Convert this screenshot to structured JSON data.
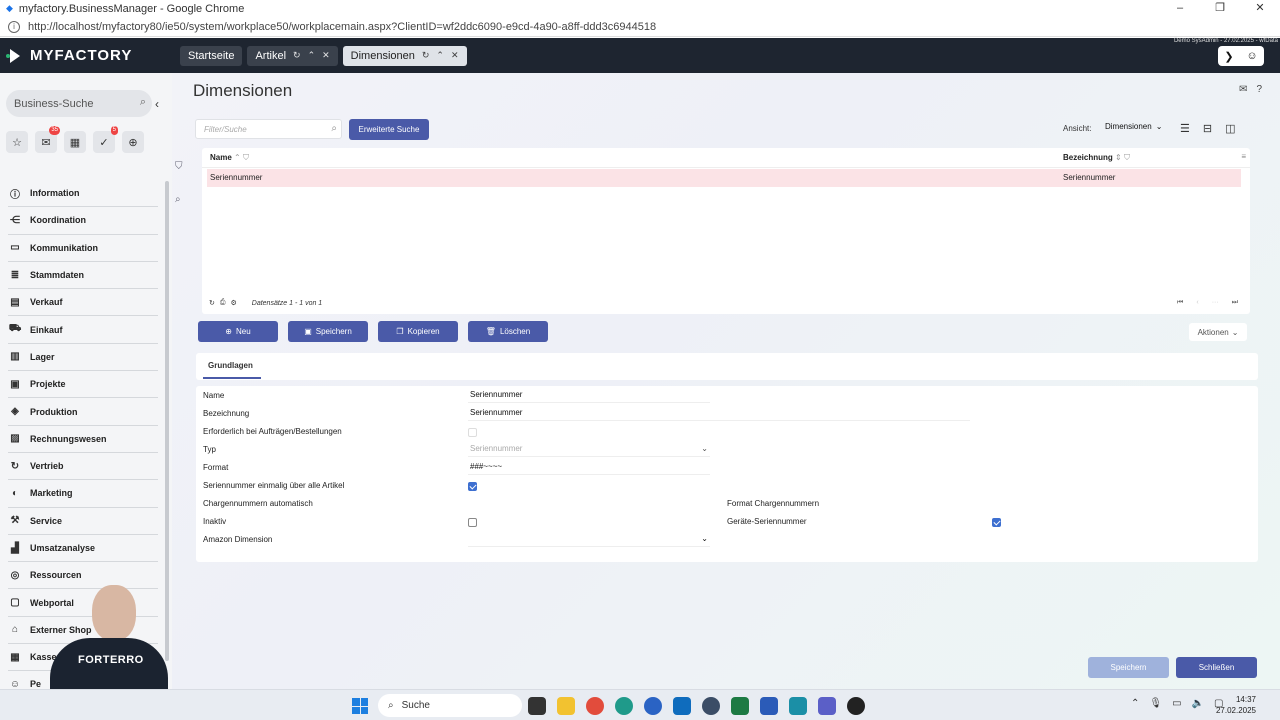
{
  "browser": {
    "window_title": "myfactory.BusinessManager - Google Chrome",
    "url": "http://localhost/myfactory80/ie50/system/workplace50/workplacemain.aspx?ClientID=wf2ddc6090-e9cd-4a90-a8ff-ddd3c6944518"
  },
  "header": {
    "logo": "MYFACTORY",
    "tabs": [
      {
        "label": "Startseite"
      },
      {
        "label": "Artikel"
      },
      {
        "label": "Dimensionen"
      }
    ],
    "user_info": "Demo SysAdmin - 27.02.2025 - wfData"
  },
  "sidebar": {
    "search_label": "Business-Suche",
    "quick_badges": {
      "mail": "35",
      "tasks": "5"
    },
    "items": [
      {
        "label": "Information"
      },
      {
        "label": "Koordination"
      },
      {
        "label": "Kommunikation"
      },
      {
        "label": "Stammdaten"
      },
      {
        "label": "Verkauf"
      },
      {
        "label": "Einkauf"
      },
      {
        "label": "Lager"
      },
      {
        "label": "Projekte"
      },
      {
        "label": "Produktion"
      },
      {
        "label": "Rechnungswesen"
      },
      {
        "label": "Vertrieb"
      },
      {
        "label": "Marketing"
      },
      {
        "label": "Service"
      },
      {
        "label": "Umsatzanalyse"
      },
      {
        "label": "Ressourcen"
      },
      {
        "label": "Webportal"
      },
      {
        "label": "Externer Shop"
      },
      {
        "label": "Kasse"
      },
      {
        "label": "Pe"
      }
    ],
    "overlay_text": "FORTERRO"
  },
  "main": {
    "title": "Dimensionen",
    "filter_placeholder": "Filter/Suche",
    "extended_search": "Erweiterte Suche",
    "view_label": "Ansicht:",
    "view_value": "Dimensionen",
    "grid": {
      "columns": [
        "Name",
        "Bezeichnung"
      ],
      "rows": [
        {
          "name": "Seriennummer",
          "bezeichnung": "Seriennummer"
        }
      ],
      "records": "Datensätze 1 - 1 von 1"
    },
    "actions": {
      "new": "Neu",
      "save": "Speichern",
      "copy": "Kopieren",
      "delete": "Löschen",
      "more": "Aktionen"
    },
    "tab": "Grundlagen",
    "form": {
      "name_label": "Name",
      "name_value": "Seriennummer",
      "bez_label": "Bezeichnung",
      "bez_value": "Seriennummer",
      "req_label": "Erforderlich bei Aufträgen/Bestellungen",
      "req_checked": false,
      "typ_label": "Typ",
      "typ_value": "Seriennummer",
      "format_label": "Format",
      "format_value": "###~~~~",
      "unique_label": "Seriennummer einmalig über alle Artikel",
      "unique_checked": true,
      "charge_auto_label": "Chargennummern automatisch",
      "charge_format_label": "Format Chargennummern",
      "inactive_label": "Inaktiv",
      "inactive_checked": false,
      "device_serial_label": "Geräte-Seriennummer",
      "device_serial_checked": true,
      "amazon_label": "Amazon Dimension",
      "amazon_value": ""
    },
    "footer": {
      "save": "Speichern",
      "close": "Schließen"
    }
  },
  "taskbar": {
    "search": "Suche",
    "time": "14:37",
    "date": "27.02.2025"
  }
}
